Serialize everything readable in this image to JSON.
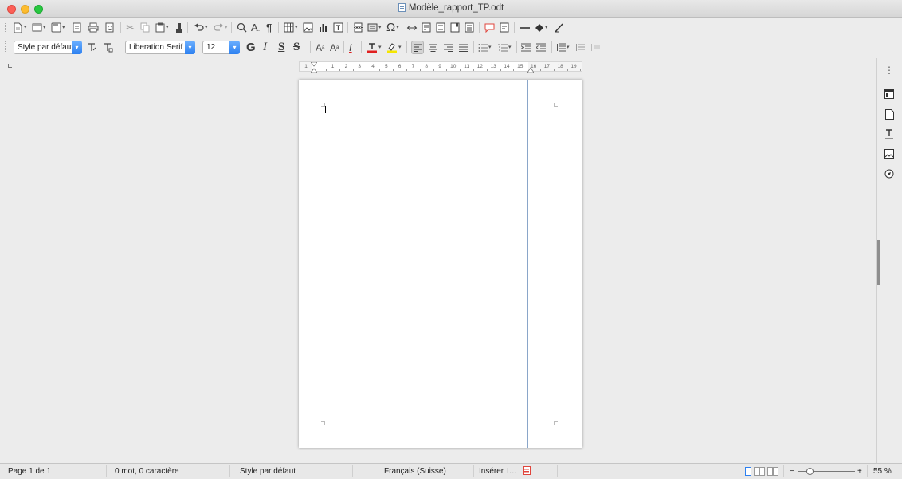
{
  "window": {
    "title": "Modèle_rapport_TP.odt"
  },
  "formatting": {
    "paragraph_style": "Style par défaut",
    "font_name": "Liberation Serif",
    "font_size": "12",
    "bold_label": "G",
    "italic_label": "I",
    "underline_label": "S",
    "strike_label": "S"
  },
  "ruler": {
    "labels": [
      "1",
      "",
      "1",
      "2",
      "3",
      "4",
      "5",
      "6",
      "7",
      "8",
      "9",
      "10",
      "11",
      "12",
      "13",
      "14",
      "15",
      "16",
      "17",
      "18",
      "19"
    ]
  },
  "status": {
    "page": "Page 1 de 1",
    "words": "0 mot, 0 caractère",
    "page_style": "Style par défaut",
    "language": "Français (Suisse)",
    "insert_mode": "Insérer",
    "selection_mode": "I…",
    "zoom": "55 %",
    "zoom_minus": "−",
    "zoom_plus": "+"
  },
  "colors": {
    "accent": "#2d80f0",
    "font_color": "#e02020",
    "highlight": "#f5e600"
  }
}
